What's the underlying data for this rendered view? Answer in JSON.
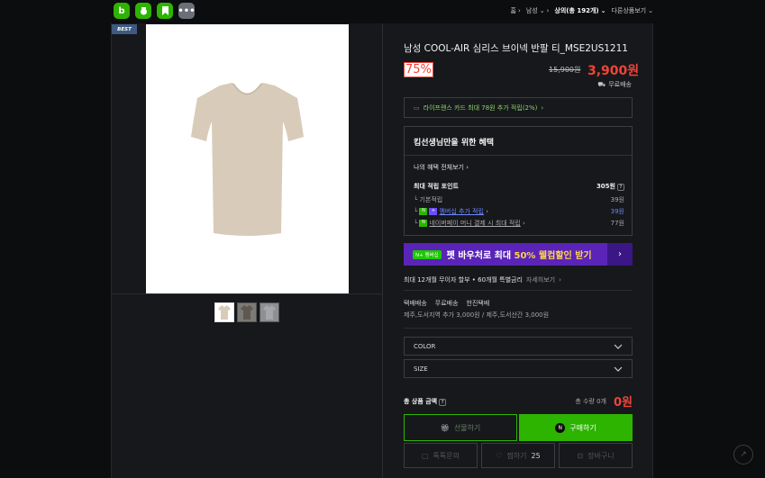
{
  "topbar": {
    "apps": [
      {
        "label": "b",
        "icon": "blog-icon"
      },
      {
        "label": "",
        "icon": "cafe-icon"
      },
      {
        "label": "",
        "icon": "bookmark-icon"
      },
      {
        "label": "•••",
        "icon": "more-icon"
      }
    ],
    "breadcrumb": [
      {
        "label": "홈",
        "strong": false
      },
      {
        "label": "남성",
        "strong": false
      },
      {
        "label": "상의(총 192개)",
        "strong": true
      },
      {
        "label": "다른상품보기",
        "strong": false
      }
    ]
  },
  "gallery": {
    "badge": "BEST",
    "thumbnails": [
      "beige",
      "brown",
      "gray"
    ]
  },
  "product": {
    "title": "남성 COOL-AIR 심리스 브이넥 반팔 티_MSE2US1211",
    "discount": "75%",
    "original_price": "15,900원",
    "sale_price": "3,900원",
    "shipping": "무료배송"
  },
  "card_benefit": "라이프렌스 카드 최대 78원 추가 적립(2%)",
  "benefits": {
    "heading": "킴선생님만을 위한 혜택",
    "view_all": "나의 혜택 전체보기",
    "max_points_label": "최대 적립 포인트",
    "max_points_value": "305원",
    "rows": [
      {
        "label": "기본적립",
        "value": "39원"
      },
      {
        "label": "멤버십 추가 적립",
        "value": "39원"
      },
      {
        "label": "네이버페이 머니 결제 시 최대 적립",
        "value": "77원"
      }
    ]
  },
  "promo": {
    "pill": "N+ 멤버십",
    "text_before": "펫 바우처로 최대 ",
    "text_highlight": "50% 웰컴할인 받기"
  },
  "installment": {
    "text": "최대 12개월 무이자 할부 • 60개월 특별금리",
    "more": "자세히보기"
  },
  "delivery": {
    "items": [
      "택배배송",
      "무료배송",
      "한진택배"
    ],
    "note": "제주,도서지역 추가 3,000원 / 제주,도서산간 3,000원"
  },
  "options": {
    "color": "COLOR",
    "size": "SIZE"
  },
  "total": {
    "label": "총 상품 금액",
    "quantity": "총 수량 0개",
    "amount": "0원"
  },
  "buttons": {
    "gift": "선물하기",
    "buy": "구매하기",
    "small": [
      {
        "label": "톡톡문의",
        "count": ""
      },
      {
        "label": "찜하기",
        "count": "25"
      },
      {
        "label": "장바구니",
        "count": ""
      }
    ]
  },
  "colors": {
    "accent_green": "#2db400",
    "price_red": "#f04438",
    "promo_purple": "#5a24b8"
  }
}
